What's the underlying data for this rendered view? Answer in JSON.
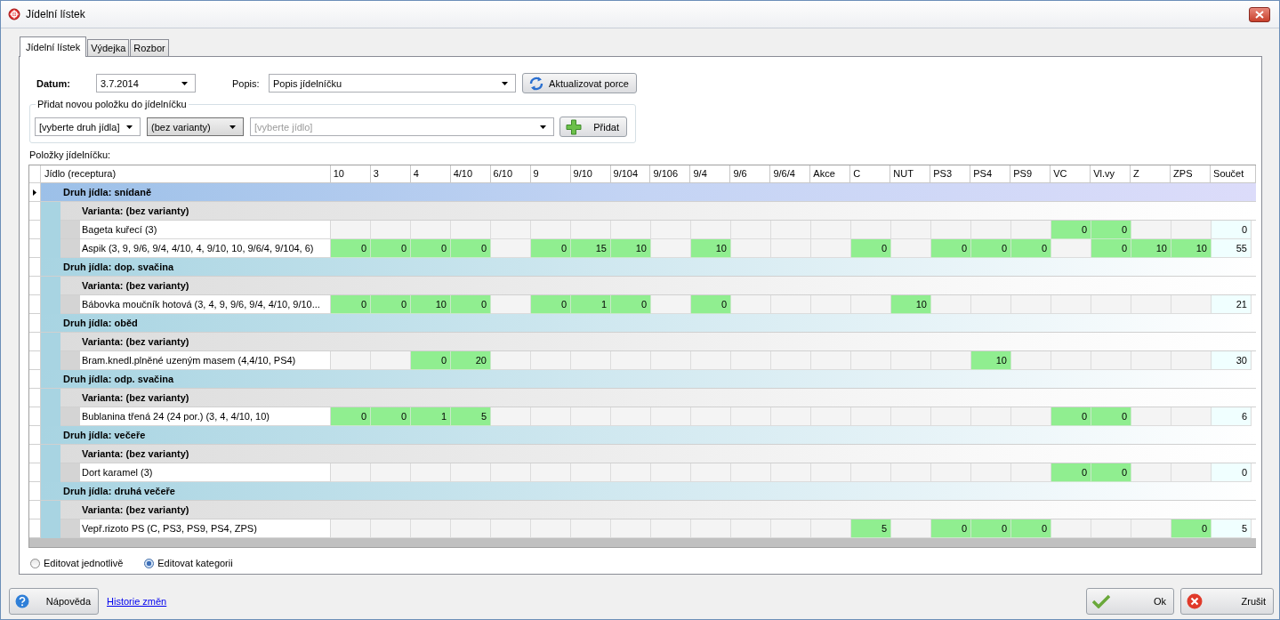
{
  "window": {
    "title": "Jídelní lístek"
  },
  "tabs": [
    {
      "label": "Jídelní lístek",
      "selected": true
    },
    {
      "label": "Výdejka",
      "selected": false
    },
    {
      "label": "Rozbor",
      "selected": false
    }
  ],
  "header": {
    "date_label": "Datum:",
    "date_value": "3.7.2014",
    "popis_label": "Popis:",
    "popis_value": "Popis jídelníčku",
    "refresh_button": "Aktualizovat porce"
  },
  "add_group": {
    "title": "Přidat novou položku do jídelníčku",
    "combos": [
      {
        "kind": "plain",
        "value": "[vyberte druh jídla]"
      },
      {
        "kind": "raised",
        "value": "(bez varianty)"
      },
      {
        "kind": "wide",
        "placeholder": "[vyberte jídlo]"
      }
    ],
    "add_button": "Přidat"
  },
  "table": {
    "title": "Položky jídelníčku:",
    "name_column": "Jídlo (receptura)",
    "columns": [
      "10",
      "3",
      "4",
      "4/10",
      "6/10",
      "9",
      "9/10",
      "9/104",
      "9/106",
      "9/4",
      "9/6",
      "9/6/4",
      "Akce",
      "C",
      "NUT",
      "PS3",
      "PS4",
      "PS9",
      "VC",
      "Vl.vy",
      "Z",
      "ZPS"
    ],
    "total_column": "Součet",
    "groups": [
      {
        "label": "Druh jídla: snídaně",
        "selected": true,
        "variants": [
          {
            "label": "Varianta: (bez varianty)",
            "items": [
              {
                "name": "Bageta kuřecí (3)",
                "cells": [
                  null,
                  null,
                  null,
                  null,
                  null,
                  null,
                  null,
                  null,
                  null,
                  null,
                  null,
                  null,
                  null,
                  null,
                  null,
                  null,
                  null,
                  null,
                  "0",
                  "0",
                  null,
                  null
                ],
                "total": "0"
              },
              {
                "name": "Aspik (3, 9, 9/6, 9/4, 4/10, 4, 9/10, 10, 9/6/4, 9/104, 6)",
                "cells": [
                  "0",
                  "0",
                  "0",
                  "0",
                  null,
                  "0",
                  "15",
                  "10",
                  null,
                  "10",
                  null,
                  null,
                  null,
                  "0",
                  null,
                  "0",
                  "0",
                  "0",
                  null,
                  "0",
                  "10",
                  "10"
                ],
                "total": "55"
              }
            ]
          }
        ]
      },
      {
        "label": "Druh jídla: dop. svačina",
        "selected": false,
        "variants": [
          {
            "label": "Varianta: (bez varianty)",
            "items": [
              {
                "name": "Bábovka moučník hotová (3, 4, 9, 9/6, 9/4, 4/10, 9/10...",
                "cells": [
                  "0",
                  "0",
                  "10",
                  "0",
                  null,
                  "0",
                  "1",
                  "0",
                  null,
                  "0",
                  null,
                  null,
                  null,
                  null,
                  "10",
                  null,
                  null,
                  null,
                  null,
                  null,
                  null,
                  null
                ],
                "total": "21"
              }
            ]
          }
        ]
      },
      {
        "label": "Druh jídla: oběd",
        "selected": false,
        "variants": [
          {
            "label": "Varianta: (bez varianty)",
            "items": [
              {
                "name": "Bram.knedl.plněné uzeným masem (4,4/10, PS4)",
                "cells": [
                  null,
                  null,
                  "0",
                  "20",
                  null,
                  null,
                  null,
                  null,
                  null,
                  null,
                  null,
                  null,
                  null,
                  null,
                  null,
                  null,
                  "10",
                  null,
                  null,
                  null,
                  null,
                  null
                ],
                "total": "30"
              }
            ]
          }
        ]
      },
      {
        "label": "Druh jídla: odp. svačina",
        "selected": false,
        "variants": [
          {
            "label": "Varianta: (bez varianty)",
            "items": [
              {
                "name": "Bublanina třená 24 (24 por.) (3, 4, 4/10, 10)",
                "cells": [
                  "0",
                  "0",
                  "1",
                  "5",
                  null,
                  null,
                  null,
                  null,
                  null,
                  null,
                  null,
                  null,
                  null,
                  null,
                  null,
                  null,
                  null,
                  null,
                  "0",
                  "0",
                  null,
                  null
                ],
                "total": "6"
              }
            ]
          }
        ]
      },
      {
        "label": "Druh jídla: večeře",
        "selected": false,
        "variants": [
          {
            "label": "Varianta: (bez varianty)",
            "items": [
              {
                "name": "Dort karamel (3)",
                "cells": [
                  null,
                  null,
                  null,
                  null,
                  null,
                  null,
                  null,
                  null,
                  null,
                  null,
                  null,
                  null,
                  null,
                  null,
                  null,
                  null,
                  null,
                  null,
                  "0",
                  "0",
                  null,
                  null
                ],
                "total": "0"
              }
            ]
          }
        ]
      },
      {
        "label": "Druh jídla: druhá večeře",
        "selected": false,
        "variants": [
          {
            "label": "Varianta: (bez varianty)",
            "items": [
              {
                "name": "Vepř.rizoto PS (C, PS3, PS9, PS4, ZPS)",
                "cells": [
                  null,
                  null,
                  null,
                  null,
                  null,
                  null,
                  null,
                  null,
                  null,
                  null,
                  null,
                  null,
                  null,
                  "5",
                  null,
                  "0",
                  "0",
                  "0",
                  null,
                  null,
                  null,
                  "0"
                ],
                "total": "5"
              }
            ]
          }
        ]
      }
    ]
  },
  "edit_modes": [
    {
      "label": "Editovat jednotlivě",
      "selected": false
    },
    {
      "label": "Editovat kategorii",
      "selected": true
    }
  ],
  "footer": {
    "help_button": "Nápověda",
    "history_link": "Historie změn",
    "ok_button": "Ok",
    "cancel_button": "Zrušit"
  }
}
